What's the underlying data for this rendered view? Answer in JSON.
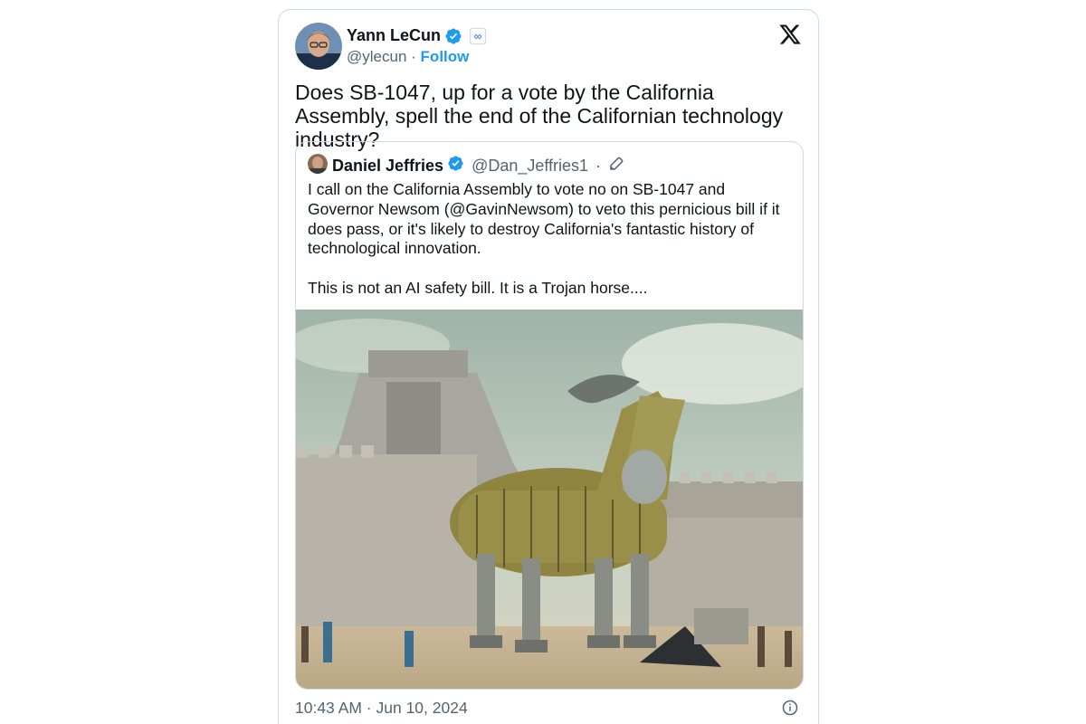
{
  "author": {
    "name": "Yann LeCun",
    "handle": "@ylecun",
    "separator": "·",
    "follow_label": "Follow",
    "verified_icon": "verified-badge-icon",
    "affiliation_icon": "meta-icon"
  },
  "tweet": {
    "text": "Does SB-1047, up for a vote by the California Assembly, spell the end of the Californian technology industry?",
    "timestamp": "10:43 AM · Jun 10, 2024"
  },
  "quoted_tweet": {
    "name": "Daniel Jeffries",
    "handle": "@Dan_Jeffries1",
    "separator": "·",
    "paragraphs": [
      "I call on the California Assembly to vote no on SB-1047 and Governor Newsom (@GavinNewsom) to veto this pernicious bill if it does pass, or it's likely to destroy California's fantastic history of technological innovation.",
      "This is not an AI safety bill. It is a Trojan horse...."
    ],
    "image_subject": "trojan-horse-illustration"
  },
  "colors": {
    "link": "#1d9bf0",
    "secondary_text": "#536471",
    "border": "#cfd9de",
    "verified": "#1d9bf0"
  }
}
